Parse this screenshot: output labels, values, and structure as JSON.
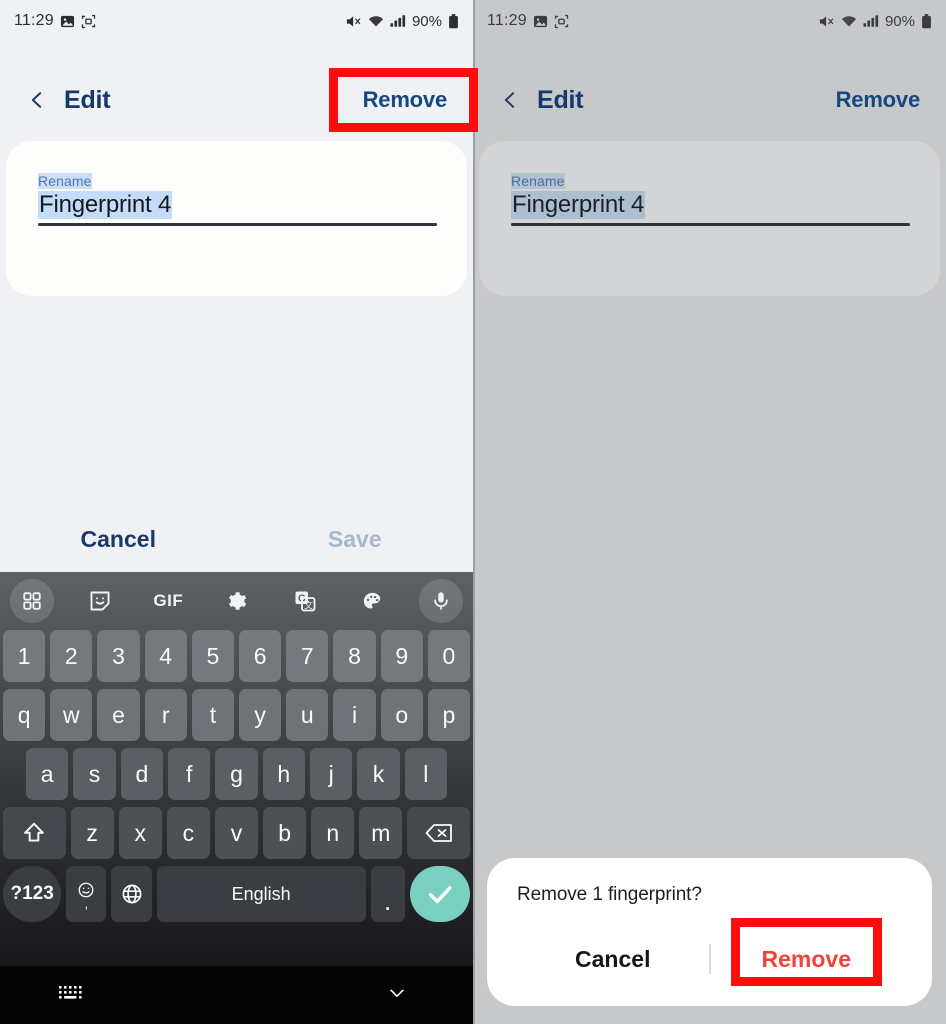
{
  "status_bar": {
    "time": "11:29",
    "left_icons": [
      "photo-icon",
      "screenshot-capture-icon"
    ],
    "right_icons": [
      "mute-icon",
      "wifi-icon",
      "signal-icon"
    ],
    "battery_percent": "90%",
    "battery_icon": "battery-icon"
  },
  "app_bar": {
    "back_icon": "back-chevron-icon",
    "title": "Edit",
    "action_label": "Remove"
  },
  "rename_card": {
    "label": "Rename",
    "value": "Fingerprint 4"
  },
  "edit_actions": {
    "cancel_label": "Cancel",
    "save_label": "Save"
  },
  "keyboard": {
    "toolbar": [
      {
        "name": "apps-grid-icon",
        "label": ""
      },
      {
        "name": "sticker-icon",
        "label": ""
      },
      {
        "name": "gif-icon",
        "label": "GIF"
      },
      {
        "name": "settings-gear-icon",
        "label": ""
      },
      {
        "name": "google-translate-icon",
        "label": ""
      },
      {
        "name": "palette-icon",
        "label": ""
      },
      {
        "name": "microphone-icon",
        "label": ""
      }
    ],
    "row_numbers": [
      "1",
      "2",
      "3",
      "4",
      "5",
      "6",
      "7",
      "8",
      "9",
      "0"
    ],
    "row_top": [
      "q",
      "w",
      "e",
      "r",
      "t",
      "y",
      "u",
      "i",
      "o",
      "p"
    ],
    "row_home": [
      "a",
      "s",
      "d",
      "f",
      "g",
      "h",
      "j",
      "k",
      "l"
    ],
    "row_bottom": [
      "z",
      "x",
      "c",
      "v",
      "b",
      "n",
      "m"
    ],
    "shift_icon": "shift-arrow-icon",
    "backspace_icon": "backspace-icon",
    "symbols_label": "?123",
    "emoji_icon": "emoji-smiley-icon",
    "emoji_secondary": ",",
    "globe_icon": "language-globe-icon",
    "space_label": "English",
    "period_label": ".",
    "enter_icon": "check-enter-icon"
  },
  "nav_bar": {
    "keyboard_icon": "hide-keyboard-icon",
    "down_icon": "chevron-down-icon"
  },
  "dialog": {
    "title": "Remove 1 fingerprint?",
    "cancel_label": "Cancel",
    "remove_label": "Remove"
  },
  "colors": {
    "accent_blue": "#17477f",
    "highlight_red": "#fd0d0d",
    "dialog_remove_red": "#f44336",
    "enter_key_teal": "#79cfc0",
    "text_selection": "#c4dcf8"
  }
}
